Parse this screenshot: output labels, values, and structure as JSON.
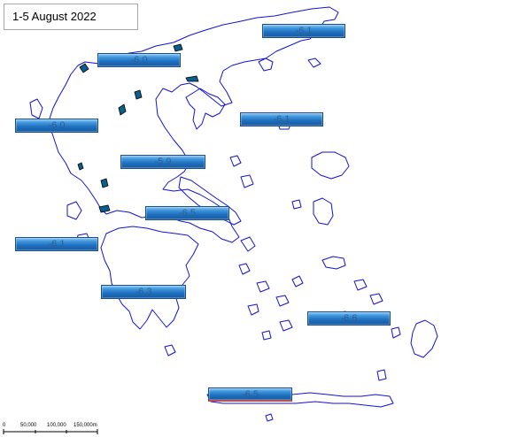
{
  "title": "1-5 August 2022",
  "map_line_color": "#1212d6",
  "badge_color": "#1f6fbf",
  "stations": [
    {
      "value": "-6.1"
    },
    {
      "value": "-6.0"
    },
    {
      "value": "-6.0"
    },
    {
      "value": "-6.1"
    },
    {
      "value": "-5.9"
    },
    {
      "value": "-6.5"
    },
    {
      "value": "-6.1"
    },
    {
      "value": "-6.3"
    },
    {
      "value": "-6.6"
    },
    {
      "value": "-6.5"
    }
  ],
  "scalebar": {
    "labels": [
      "0",
      "50,000",
      "100,000",
      "150,000m"
    ]
  }
}
